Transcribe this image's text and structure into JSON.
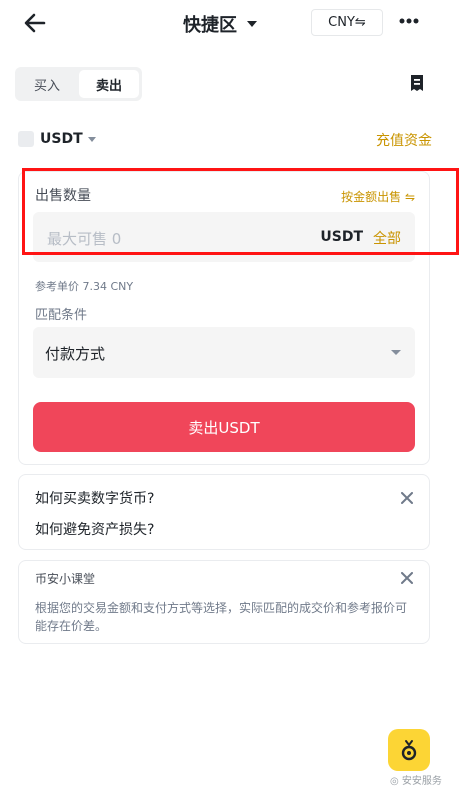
{
  "header": {
    "title": "快捷区",
    "currency_label": "CNY⇋"
  },
  "tabs": [
    {
      "label": "买入"
    },
    {
      "label": "卖出"
    }
  ],
  "coin": {
    "label": "USDT",
    "deposit_label": "充值资金"
  },
  "sell_form": {
    "quantity_label": "出售数量",
    "by_amount_label": "按金额出售 ⇋",
    "quantity_placeholder": "最大可售 0",
    "quantity_unit": "USDT",
    "all_label": "全部",
    "reference_price": "参考单价 7.34 CNY",
    "match_label": "匹配条件",
    "payment_label": "付款方式",
    "submit_label": "卖出USDT"
  },
  "faq": {
    "q1": "如何买卖数字货币?",
    "q2": "如何避免资产损失?"
  },
  "tips": {
    "title": "币安小课堂",
    "body": "根据您的交易金额和支付方式等选择，实际匹配的成交价和参考报价可能存在价差。"
  },
  "watermark": "◎ 安安服务",
  "colors": {
    "accent": "#c99400",
    "sell": "#f0465a",
    "brand": "#fcd535",
    "highlight": "#ff1414"
  }
}
